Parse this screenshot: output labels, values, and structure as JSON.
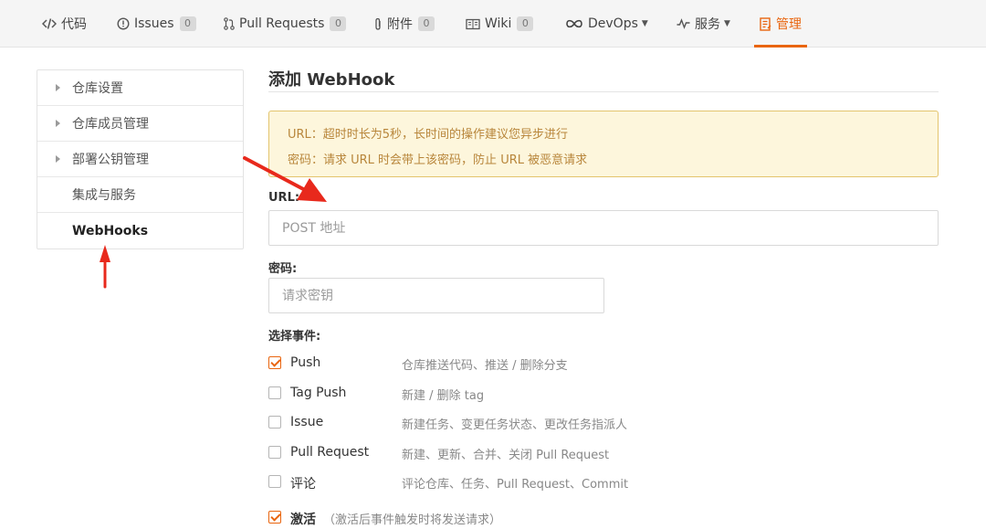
{
  "nav": {
    "tabs": [
      {
        "label": "代码",
        "icon": "code-icon"
      },
      {
        "label": "Issues",
        "icon": "issue-icon",
        "count": "0"
      },
      {
        "label": "Pull Requests",
        "icon": "pull-request-icon",
        "count": "0"
      },
      {
        "label": "附件",
        "icon": "paperclip-icon",
        "count": "0"
      },
      {
        "label": "Wiki",
        "icon": "book-icon",
        "count": "0"
      },
      {
        "label": "DevOps",
        "icon": "infinity-icon",
        "dropdown": true
      },
      {
        "label": "服务",
        "icon": "pulse-icon",
        "dropdown": true
      },
      {
        "label": "管理",
        "icon": "manage-icon",
        "active": true
      }
    ],
    "active_color": "#e9650f"
  },
  "sidebar": {
    "items": [
      {
        "label": "仓库设置",
        "expandable": true
      },
      {
        "label": "仓库成员管理",
        "expandable": true
      },
      {
        "label": "部署公钥管理",
        "expandable": true
      },
      {
        "label": "集成与服务",
        "expandable": false
      },
      {
        "label": "WebHooks",
        "expandable": false,
        "active": true
      }
    ]
  },
  "main": {
    "title": "添加 WebHook",
    "notice": {
      "line1": "URL：超时时长为5秒，长时间的操作建议您异步进行",
      "line2": "密码：请求 URL 时会带上该密码，防止 URL 被恶意请求"
    },
    "url_field": {
      "label": "URL:",
      "placeholder": "POST 地址",
      "value": ""
    },
    "password_field": {
      "label": "密码:",
      "placeholder": "请求密钥",
      "value": ""
    },
    "events_label": "选择事件:",
    "events": [
      {
        "name": "Push",
        "desc": "仓库推送代码、推送 / 删除分支",
        "checked": true
      },
      {
        "name": "Tag Push",
        "desc": "新建 / 删除 tag",
        "checked": false
      },
      {
        "name": "Issue",
        "desc": "新建任务、变更任务状态、更改任务指派人",
        "checked": false
      },
      {
        "name": "Pull Request",
        "desc": "新建、更新、合并、关闭 Pull Request",
        "checked": false
      },
      {
        "name": "评论",
        "desc": "评论仓库、任务、Pull Request、Commit",
        "checked": false
      }
    ],
    "activate": {
      "label": "激活",
      "note": "（激活后事件触发时将发送请求）",
      "checked": true
    }
  },
  "annotations": {
    "arrow_color": "#e8291c"
  }
}
